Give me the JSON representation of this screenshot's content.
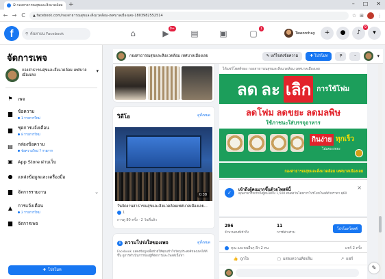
{
  "browser": {
    "tab_title": "Ձ กองสาธารณสุขและสิ่งแวดล้อม ×",
    "new_tab": "+",
    "window_controls": [
      "–",
      "□",
      "✕"
    ],
    "url": "▲ facebook.com/กองสาธารณสุขและสิ่งแวดล้อม-เทศบาลเมืองเลย-1803982552514"
  },
  "fb": {
    "search_placeholder": "ค้นหาบน Facebook",
    "nav_badges": {
      "watch": "9+",
      "notifications": "1"
    },
    "user_name": "Taworchay",
    "account_badge": "9"
  },
  "sidebar": {
    "title": "จัดการเพจ",
    "page_name": "กองสาธารณสุขและสิ่งแวดล้อม เทศบาลเมืองเลย",
    "items": [
      {
        "label": "เพจ",
        "sub": ""
      },
      {
        "label": "ข้อความ",
        "sub": "1 รายการใหม่"
      },
      {
        "label": "ชุดการแจ้งเตือน",
        "sub": "8 รายการใหม่"
      },
      {
        "label": "กล่องข้อความ",
        "sub": "ข้อความใหม่ 7 รายการ"
      },
      {
        "label": "App Store ผ่านเว็บ",
        "sub": ""
      },
      {
        "label": "แหล่งข้อมูลและเครื่องมือ",
        "sub": ""
      },
      {
        "label": "จัดการรายงาน",
        "sub": ""
      },
      {
        "label": "การแจ้งเตือน",
        "sub": "2 รายการใหม่"
      },
      {
        "label": "จัดการเพจ",
        "sub": ""
      }
    ],
    "promote_label": "โปรโมท"
  },
  "page_header": {
    "page_name": "กองสาธารณสุขและสิ่งแวดล้อม เทศบาลเมืองเลย",
    "edit_button": "แก้ไขส่งข้อความ",
    "promote_button": "โปรโมท"
  },
  "video_card": {
    "title": "วิดีโอ",
    "see_all": "ดูทั้งหมด",
    "duration": "0:38",
    "caption": "วันจัดงานสาธารณสุขและสิ่งแวดล้อมเทศบาลเมืองเลย...",
    "likes": "1",
    "meta": "การดู 80 ครั้ง · 2 วันที่แล้ว"
  },
  "about_card": {
    "title": "ความโปร่งใสของเพจ",
    "see_all": "ดูทั้งหมด",
    "text": "Facebook แสดงข้อมูลเพื่อช่วยให้คุณเข้าใจวัตถุประสงค์ของเพจได้ดีขึ้น ดูการดำเนินการของผู้ที่จัดการและโพสต์เนื้อหา"
  },
  "post": {
    "header": "ได้แชร์โพสต์ของ กองสาธารณสุขและสิ่งแวดล้อม เทศบาลเมืองเลย",
    "poster": {
      "line1_a": "ลด",
      "line1_b": "ละ",
      "line1_c": "เลิก",
      "line1_tail": "การใช้โฟม",
      "line2": "ลดโฟม ลดขยะ ลดมลพิษ",
      "line3": "ใช้ภาชนะใส่บรรจุอาหาร",
      "eat": "กินง่าย",
      "fast": "ทุกเร็ว",
      "clean": "ไม่เลอะเทอะ",
      "footer": "กองสาธารณสุขและสิ่งแวดล้อม เทศบาลเมืองเลย"
    },
    "boost_title": "เข้าถึงผู้คนมากขึ้นด้วยโพสต์นี้",
    "boost_text": "คุณสามารถเข้าถึงผู้คนได้ถึง 1,500 คนต่อวันโดยการโปรโมทโพสต์ด้วยราคา ฿60",
    "stat1_num": "296",
    "stat1_label": "จำนวนคนที่เข้าถึง",
    "stat2_num": "11",
    "stat2_label": "การมีส่วนร่วม",
    "boost_button": "โปรโมทโพสต์",
    "reactions": "คุณ และคนอื่นๆ อีก 2 คน",
    "shares": "แชร์ 2 ครั้ง",
    "action_like": "ถูกใจ",
    "action_comment": "แสดงความคิดเห็น",
    "action_share": "แชร์"
  }
}
